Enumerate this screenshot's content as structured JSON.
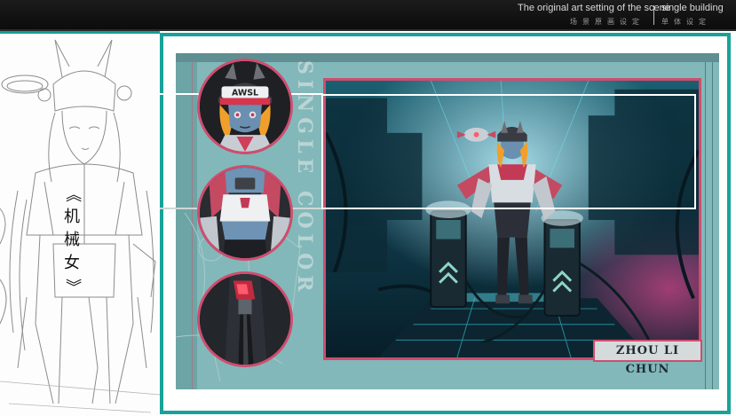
{
  "header": {
    "subtitle_en": "The original art setting of the scene",
    "subtitle_cn": "场景原画设定",
    "category_en": "single building",
    "category_cn": "单体设定"
  },
  "sidebar": {
    "bracket_open": "《",
    "title_chars": [
      "机",
      "械",
      "女"
    ],
    "bracket_close": "》"
  },
  "panel": {
    "vertical_text": "SINGLE COLOR"
  },
  "cap_text": "AWSL",
  "signature": "ZHOU LI CHUN",
  "colors": {
    "teal_border": "#17a39a",
    "panel_bg": "#82b8b9",
    "accent_pink": "#cf4d6f",
    "topbar": "#111111"
  },
  "icons": {
    "portrait_face": "character-face-icon",
    "portrait_torso": "character-torso-icon",
    "portrait_weapon": "weapon-detail-icon",
    "lineart": "lineart-sketch-icon"
  }
}
